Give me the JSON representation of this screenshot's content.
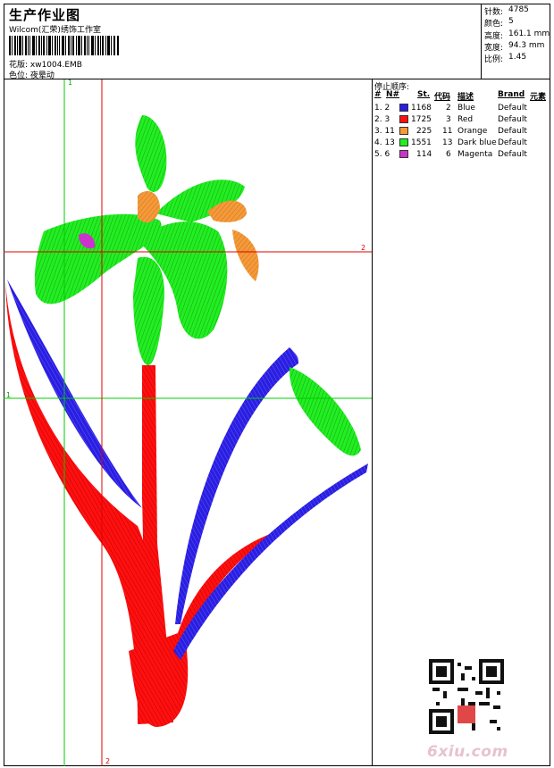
{
  "header": {
    "title": "生产作业图",
    "studio": "Wilcom(汇荣)绣饰工作室",
    "design_line": "花版: xw1004.EMB",
    "color_line": "色位: 夜晕动"
  },
  "stats": [
    {
      "label": "针数:",
      "value": "4785"
    },
    {
      "label": "颜色:",
      "value": "5"
    },
    {
      "label": "高度:",
      "value": "161.1 mm"
    },
    {
      "label": "宽度:",
      "value": "94.3 mm"
    },
    {
      "label": "比例:",
      "value": "1.45"
    }
  ],
  "stop_sequence": {
    "title": "停止顺序:",
    "headers": [
      "#",
      "N#",
      "St.",
      "代码",
      "描述",
      "Brand",
      "元素"
    ],
    "rows": [
      {
        "idx": "1. 2",
        "stitches": "1168",
        "code": "2",
        "desc": "Blue",
        "brand": "Default",
        "color": "#2a1ee0"
      },
      {
        "idx": "2. 3",
        "stitches": "1725",
        "code": "3",
        "desc": "Red",
        "brand": "Default",
        "color": "#ff1010"
      },
      {
        "idx": "3. 11",
        "stitches": "225",
        "code": "11",
        "desc": "Orange",
        "brand": "Default",
        "color": "#f59a3a"
      },
      {
        "idx": "4. 13",
        "stitches": "1551",
        "code": "13",
        "desc": "Dark blue",
        "brand": "Default",
        "color": "#22ee22"
      },
      {
        "idx": "5. 6",
        "stitches": "114",
        "code": "6",
        "desc": "Magenta",
        "brand": "Default",
        "color": "#cc33cc"
      }
    ]
  },
  "guides": {
    "v1": "1",
    "v2": "2",
    "h1": "1",
    "h2": "2"
  },
  "watermark": "6xiu.com",
  "colors": {
    "guide_green": "#00cc00",
    "guide_red": "#e00000",
    "green": "#22ee22",
    "red": "#ff1010",
    "blue": "#2a1ee0",
    "orange": "#f59a3a",
    "magenta": "#cc33cc"
  }
}
